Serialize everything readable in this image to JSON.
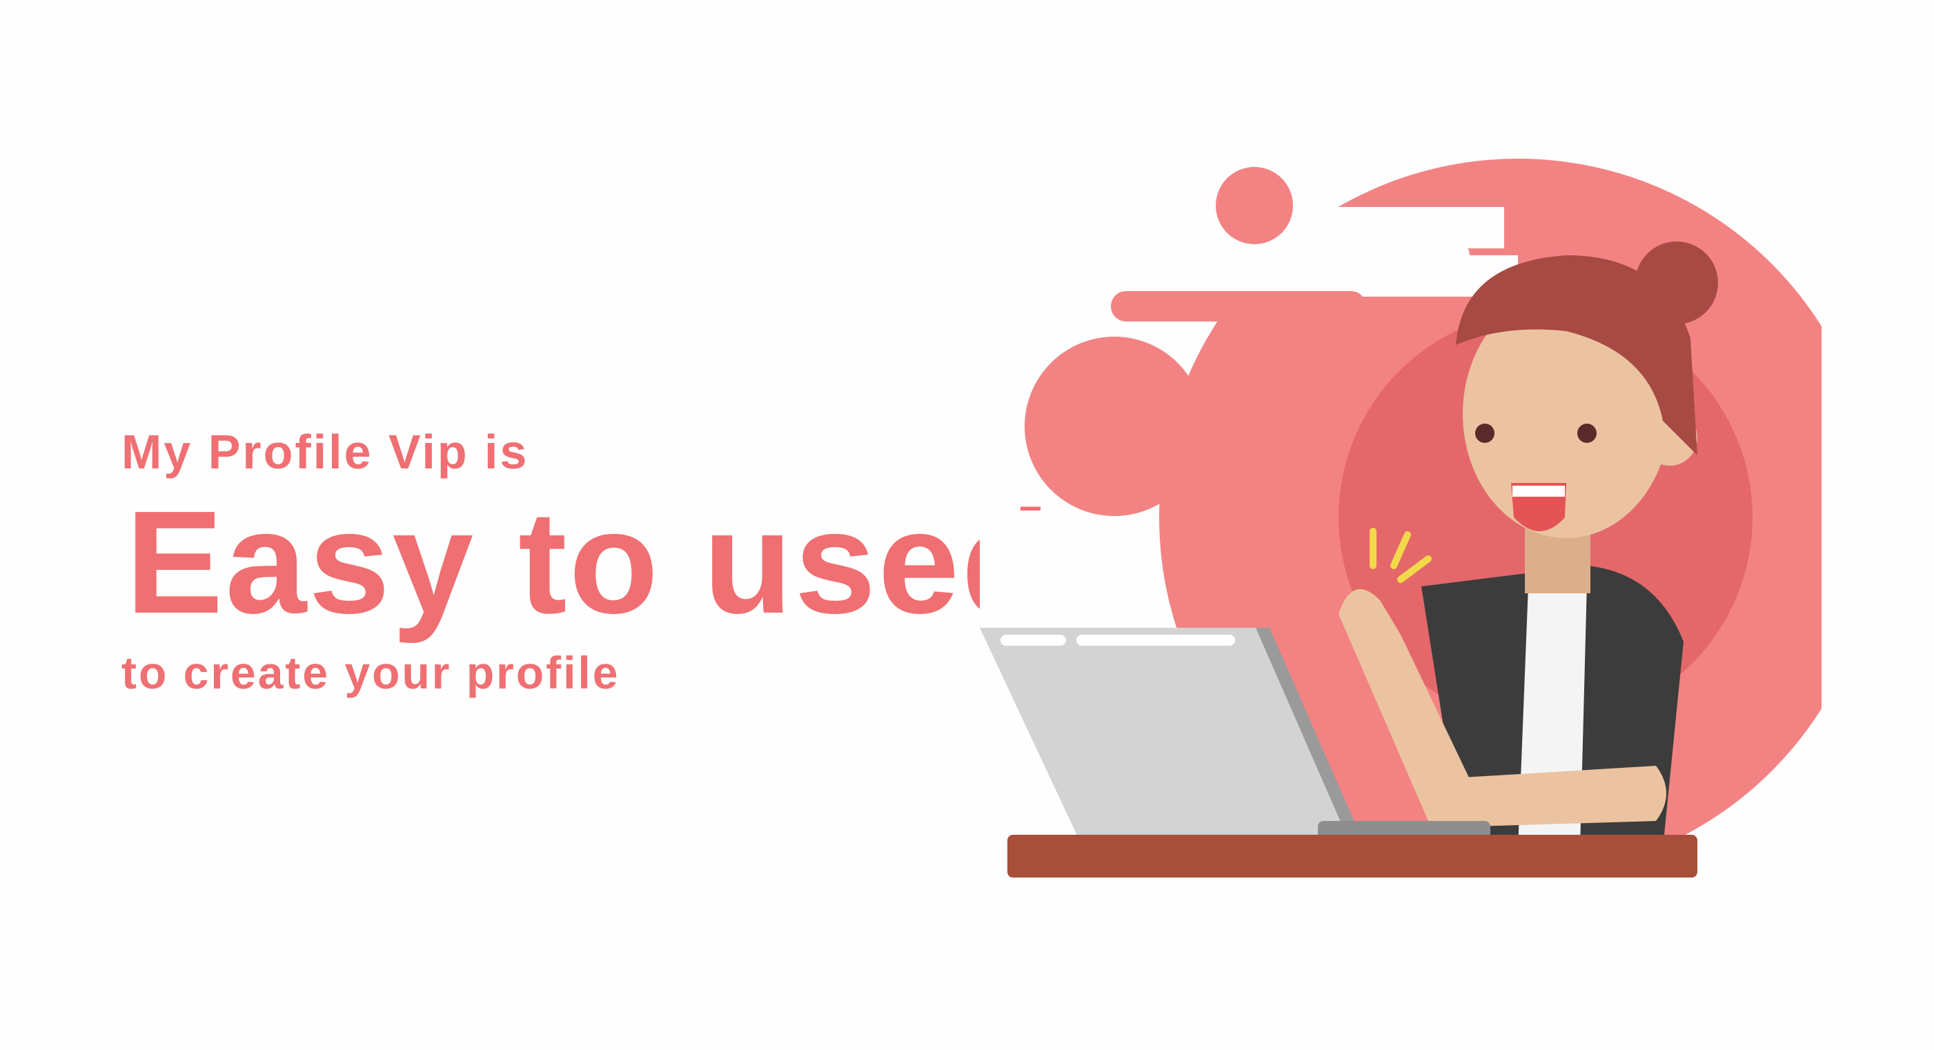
{
  "hero": {
    "line1": "My Profile Vip is",
    "line2": "Easy to used",
    "line3": "to create your profile"
  },
  "colors": {
    "accent": "#ef6f72",
    "blob": "#f38383",
    "blob_dark": "#e06466",
    "hair": "#a84a44",
    "skin": "#ecc3a0",
    "jacket": "#3c3c3c",
    "laptop": "#d3d3d3",
    "desk": "#a84f3b"
  },
  "illustration": {
    "icon": "woman-at-laptop-illustration"
  }
}
